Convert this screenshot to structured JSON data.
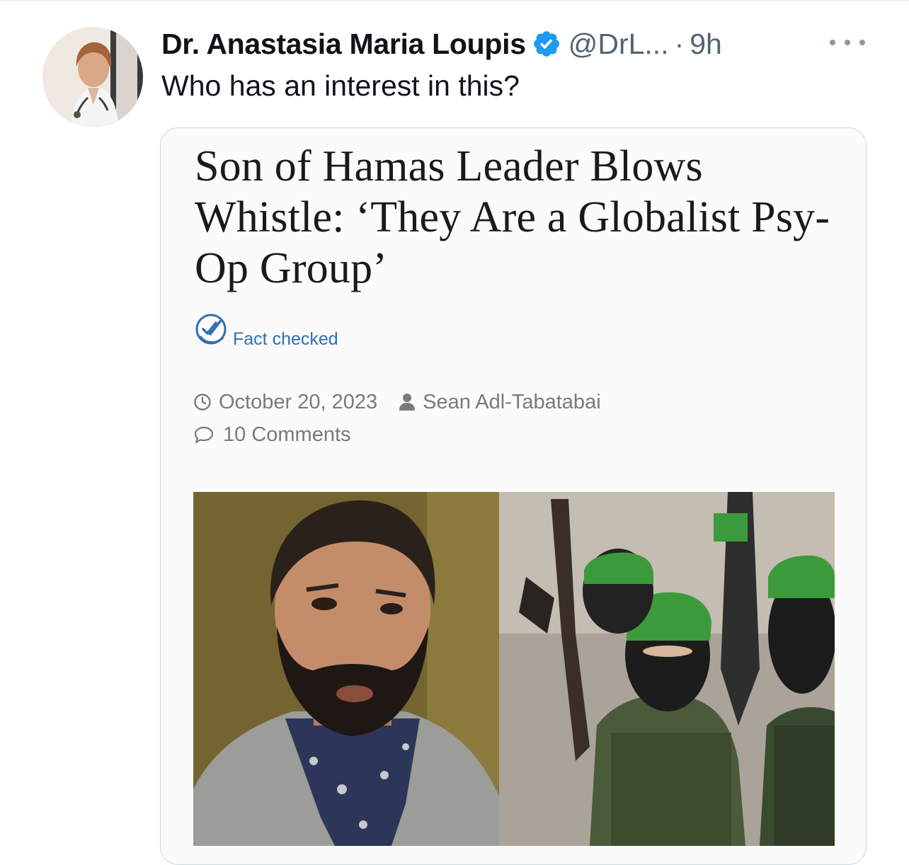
{
  "tweet": {
    "author_name": "Dr. Anastasia Maria Loupis",
    "handle": "@DrL...",
    "separator": "·",
    "time": "9h",
    "text": "Who has an interest in this?",
    "verified": true,
    "more_icon": "more-horizontal-icon"
  },
  "card": {
    "headline": "Son of Hamas Leader Blows Whistle: ‘They Are a Globalist Psy-Op Group’",
    "fact_checked_label": "Fact checked",
    "date": "October 20, 2023",
    "author": "Sean Adl-Tabatabai",
    "comments": "10 Comments",
    "icons": {
      "date": "clock-icon",
      "author": "user-icon",
      "comments": "comment-icon",
      "fact_check": "double-check-icon"
    }
  },
  "colors": {
    "verified_blue": "#1d9bf0",
    "fact_check_blue": "#2f6fb5",
    "text_primary": "#0f1419",
    "text_secondary": "#536471",
    "meta_gray": "#7a7a7a",
    "hamas_green": "#3d9a3a"
  }
}
